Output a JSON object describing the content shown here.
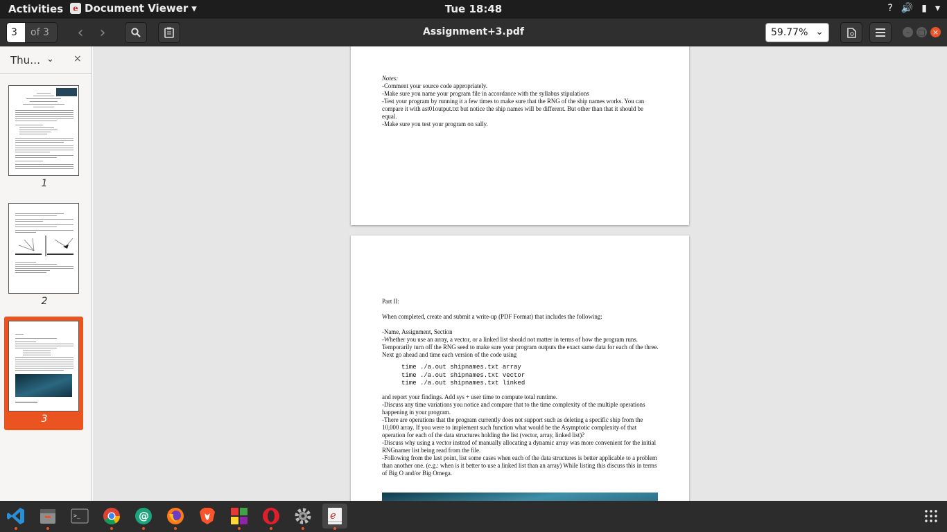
{
  "topbar": {
    "activities": "Activities",
    "app_name": "Document Viewer",
    "app_menu_arrow": "▾",
    "clock": "Tue 18:48",
    "tray": {
      "help": "?",
      "volume": "🔊",
      "battery": "▮",
      "menu": "▾"
    }
  },
  "headerbar": {
    "page_current": "3",
    "page_total": "of 3",
    "prev": "‹",
    "next": "›",
    "title": "Assignment+3.pdf",
    "zoom": "59.77%",
    "zoom_chevron": "⌄",
    "minimize": "–",
    "maximize": "□",
    "close": "×"
  },
  "sidebar": {
    "label": "Thu…",
    "chevron": "⌄",
    "close": "×",
    "thumbnails": [
      {
        "number": "1",
        "selected": false
      },
      {
        "number": "2",
        "selected": false
      },
      {
        "number": "3",
        "selected": true
      }
    ]
  },
  "document": {
    "page2_notes": [
      "Notes:",
      "-Comment your source code appropriately.",
      "-Make sure you name your program file in accordance with the syllabus stipulations",
      "-Test your program by running it a few times to make sure that the RNG of the ship names works. You can compare it with ast01output.txt but notice the ship names will be different. But other than that it should be equal.",
      "-Make sure you test your program on sally."
    ],
    "page3": {
      "heading": "Part II:",
      "intro": "When completed, create and submit a write-up (PDF Format) that includes the following:",
      "items1": [
        "-Name, Assignment, Section",
        "-Whether you use an array, a vector, or a linked list should not matter in terms of how the program runs. Temporarily turn off the RNG seed to make sure your program outputs the exact same data for each of the three. Next go ahead and time each version of the code using"
      ],
      "commands": [
        "time ./a.out shipnames.txt array",
        "time ./a.out shipnames.txt vector",
        "time ./a.out shipnames.txt linked"
      ],
      "items2": [
        "and report your findings. Add sys + user time to compute total runtime.",
        "-Discuss any time variations you notice and compare that to the time complexity of the multiple operations happening in your program.",
        "-There are operations that the program currently does not support such as deleting a specific ship from the 10,000 array. If you were to implement such function what would be the Asymptotic complexity of that operation for each of the data structures holding the list (vector, array, linked list)?",
        "-Discuss why using a vector instead of manually allocating a dynamic array was more convenient for the initial RNGnamer list being read from the file.",
        "-Following from the last point, list some cases when each of the data structures is better applicable to a problem than another one. (e.g.: when is it better to use a linked list than an array) While listing this discuss this in terms of Big O and/or Big Omega."
      ]
    }
  },
  "dock": {
    "apps": [
      {
        "name": "vscode-icon",
        "running": true
      },
      {
        "name": "files-icon",
        "running": true
      },
      {
        "name": "terminal-icon",
        "running": false
      },
      {
        "name": "chrome-icon",
        "running": true
      },
      {
        "name": "mail-icon",
        "running": true
      },
      {
        "name": "firefox-icon",
        "running": true
      },
      {
        "name": "brave-icon",
        "running": false
      },
      {
        "name": "boxes-icon",
        "running": true
      },
      {
        "name": "opera-icon",
        "running": true
      },
      {
        "name": "settings-icon",
        "running": true
      },
      {
        "name": "document-viewer-icon",
        "running": true
      }
    ],
    "colors": {
      "accent": "#e95420"
    }
  }
}
